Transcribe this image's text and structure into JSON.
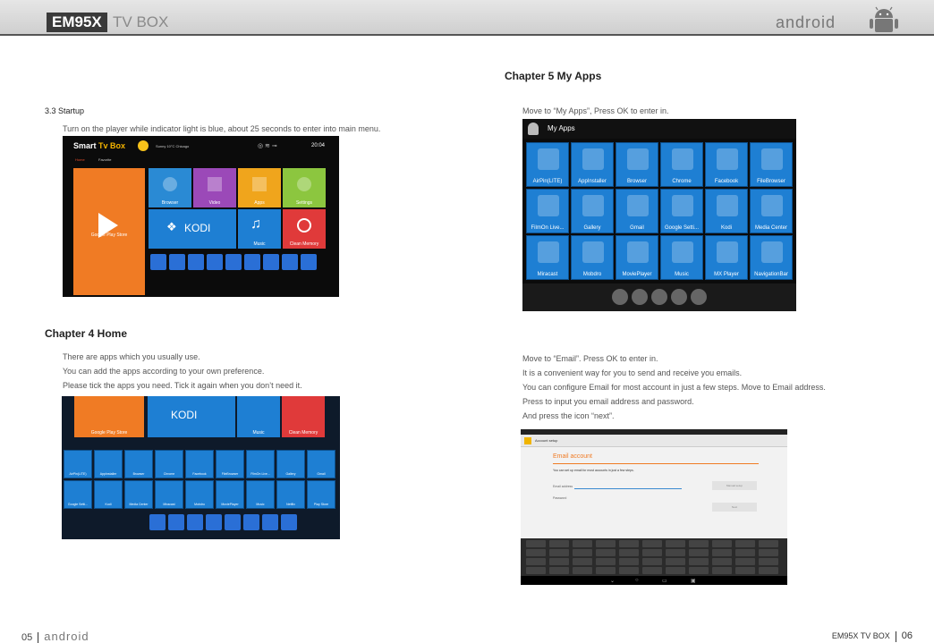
{
  "header": {
    "brand": "EM95X",
    "subtitle": "TV BOX",
    "logo_text": "android"
  },
  "left": {
    "startup": {
      "heading": "3.3 Startup",
      "text": "Turn on the player while indicator light is blue, about 25 seconds to enter into main menu."
    },
    "startup_shot": {
      "brand_a": "Smart",
      "brand_b": "Tv Box",
      "weather": "Sunny  10°C  Chicago",
      "time": "20:04",
      "nav_home": "Home",
      "nav_fav": "Favorite",
      "tiles": {
        "play": "Google Play Store",
        "browser": "Browser",
        "video": "Video",
        "apps": "Apps",
        "settings": "Settings",
        "kodi": "KODI",
        "music": "Music",
        "clean": "Clean Memory"
      }
    },
    "home": {
      "heading": "Chapter 4 Home",
      "lines": [
        "There are apps which you usually use.",
        "You can add the apps according to your own preference.",
        "Please tick the apps you need. Tick it again when you don’t need it."
      ]
    },
    "home_shot": {
      "kodi": "KODI",
      "play": "Google Play Store",
      "music": "Music",
      "clean": "Clean Memory",
      "row1": [
        "AirPin(LITE)",
        "AppInstaller",
        "Browser",
        "Chrome",
        "Facebook",
        "FileBrowser",
        "FilmOn Live...",
        "Gallery",
        "Gmail"
      ],
      "row2": [
        "Google Setti...",
        "Kodi",
        "Media Center",
        "Miracast",
        "Mobdro",
        "MoviePlayer",
        "Music",
        "Netflix",
        "Play Store"
      ]
    }
  },
  "right": {
    "myapps": {
      "heading": "Chapter 5 My Apps",
      "text": "Move to “My Apps”, Press OK to enter in."
    },
    "myapps_shot": {
      "title": "My Apps",
      "apps": [
        "AirPin(LITE)",
        "AppInstaller",
        "Browser",
        "Chrome",
        "Facebook",
        "FileBrowser",
        "FilmOn Live...",
        "Gallery",
        "Gmail",
        "Google Setti...",
        "Kodi",
        "Media Center",
        "Miracast",
        "Mobdro",
        "MoviePlayer",
        "Music",
        "MX Player",
        "NavigationBar"
      ]
    },
    "email": {
      "lines": [
        "Move to “Email”. Press OK to enter in.",
        "It is a convenient way for you to send and receive you emails.",
        "You can configure Email for most account in just a few steps. Move to Email address.",
        "Press to input you email address and password.",
        "And press the icon “next”."
      ]
    },
    "email_shot": {
      "top": "Account setup",
      "title": "Email account",
      "desc": "You can set up email for most accounts in just a few steps.",
      "field_email": "Email address",
      "field_pw": "Password",
      "btn_manual": "Manual setup",
      "btn_next": "Next"
    }
  },
  "footer": {
    "left_page": "05",
    "left_logo": "android",
    "right_label": "EM95X TV BOX",
    "right_page": "06"
  },
  "colors": {
    "tile_blue": "#1e7fd3",
    "header_bg": "#d9d9d9",
    "accent_red": "#e03a3a",
    "accent_orange": "#f07b24",
    "accent_green": "#8cc63f",
    "accent_purple": "#9b49b8"
  }
}
